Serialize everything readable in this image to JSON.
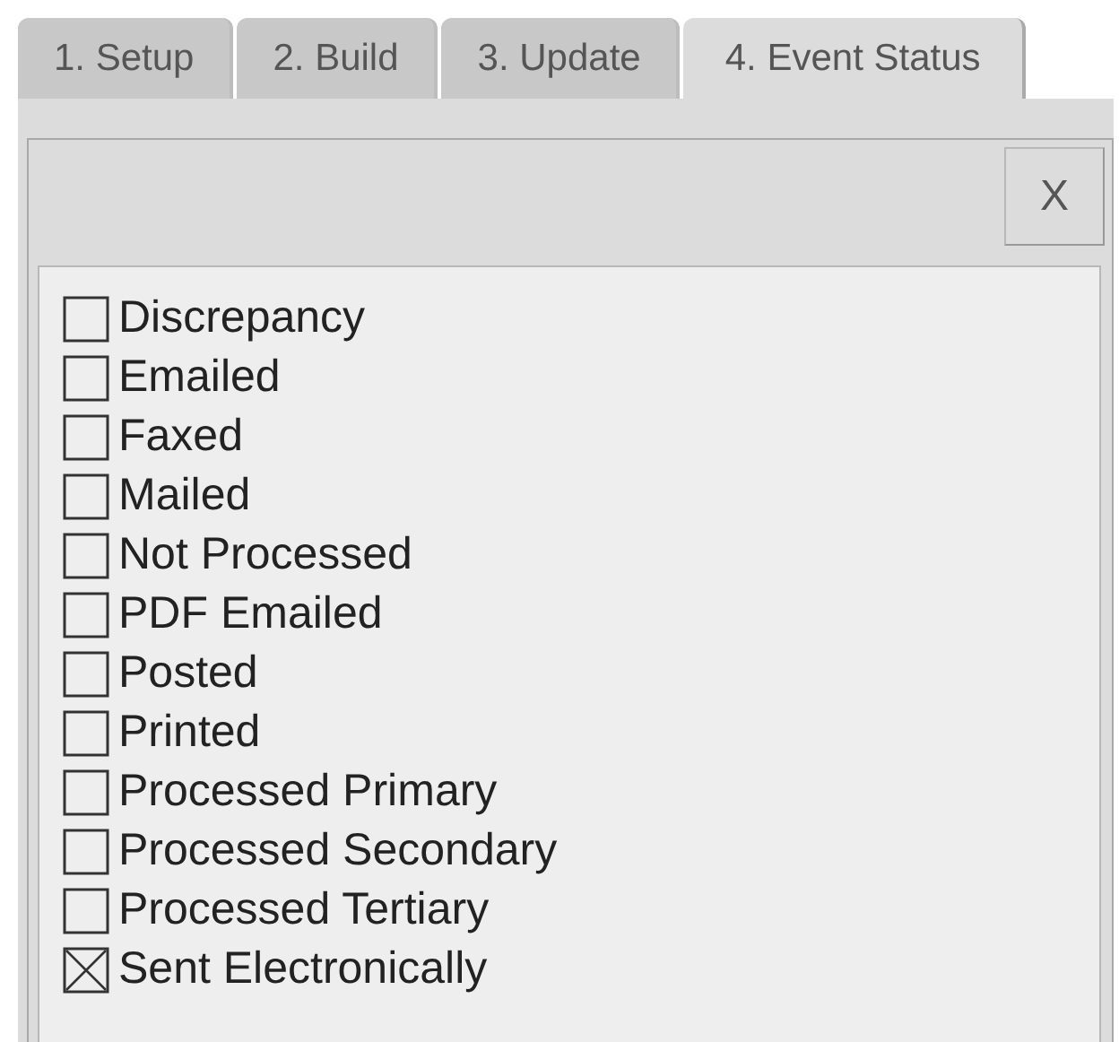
{
  "tabs": [
    {
      "label": "1. Setup",
      "selected": false
    },
    {
      "label": "2. Build",
      "selected": false
    },
    {
      "label": "3. Update",
      "selected": false
    },
    {
      "label": "4. Event Status",
      "selected": true
    }
  ],
  "close_button": "X",
  "statuses": [
    {
      "label": "Discrepancy",
      "checked": false
    },
    {
      "label": "Emailed",
      "checked": false
    },
    {
      "label": "Faxed",
      "checked": false
    },
    {
      "label": "Mailed",
      "checked": false
    },
    {
      "label": "Not Processed",
      "checked": false
    },
    {
      "label": "PDF Emailed",
      "checked": false
    },
    {
      "label": "Posted",
      "checked": false
    },
    {
      "label": "Printed",
      "checked": false
    },
    {
      "label": "Processed Primary",
      "checked": false
    },
    {
      "label": "Processed Secondary",
      "checked": false
    },
    {
      "label": "Processed Tertiary",
      "checked": false
    },
    {
      "label": "Sent Electronically",
      "checked": true
    }
  ]
}
